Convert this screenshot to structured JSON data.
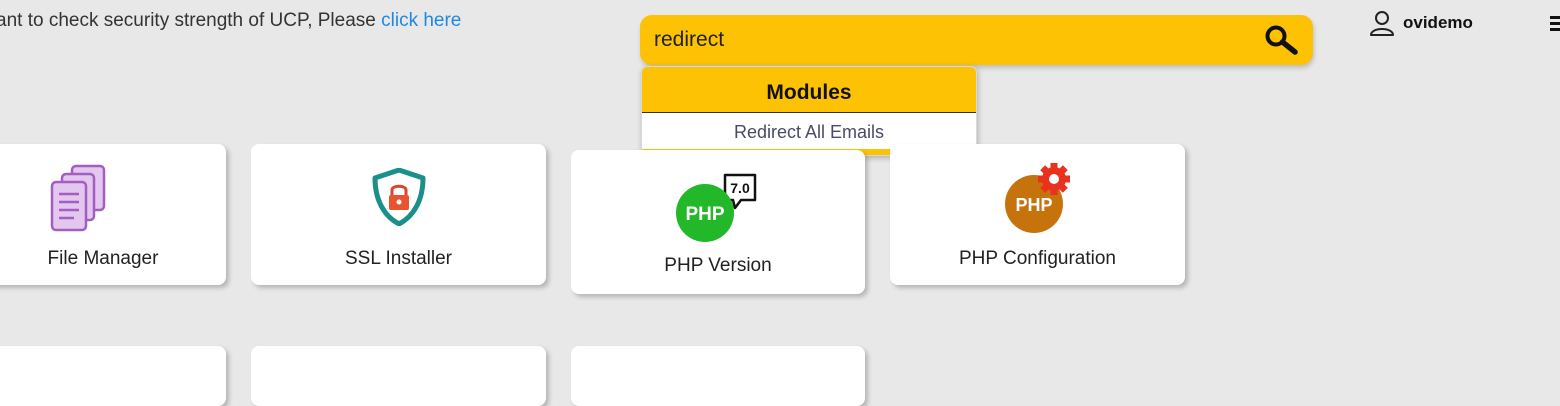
{
  "notice": {
    "text": "ant to check security strength of UCP, Please ",
    "link": "click here"
  },
  "search": {
    "value": "redirect",
    "icon": "search-icon"
  },
  "dropdown": {
    "header": "Modules",
    "items": [
      "Redirect All Emails"
    ]
  },
  "user": {
    "name": "ovidemo",
    "icon": "user-icon"
  },
  "menu": {
    "icon": "hamburger-menu-icon"
  },
  "cards": [
    {
      "label": "File Manager",
      "icon": "file-manager-icon"
    },
    {
      "label": "SSL Installer",
      "icon": "ssl-shield-icon"
    },
    {
      "label": "PHP Version",
      "icon": "php-version-icon",
      "badge": "7.0",
      "icon_text": "PHP"
    },
    {
      "label": "PHP Configuration",
      "icon": "php-configuration-icon",
      "icon_text": "PHP"
    }
  ],
  "colors": {
    "accent": "#fcc203",
    "link": "#1e88e5",
    "background": "#e9e8e8"
  }
}
